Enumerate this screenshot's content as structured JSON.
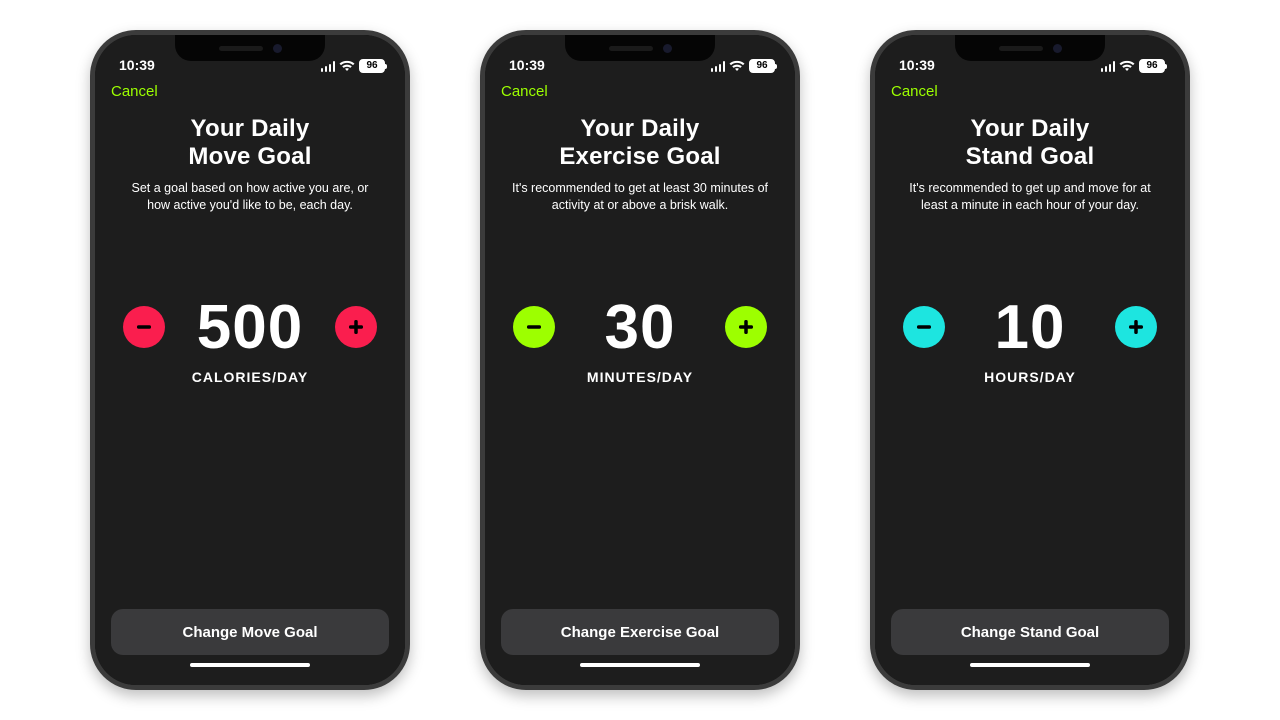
{
  "status": {
    "time": "10:39",
    "battery": "96"
  },
  "nav": {
    "cancel": "Cancel"
  },
  "screens": [
    {
      "title_line1": "Your Daily",
      "title_line2": "Move Goal",
      "subtitle": "Set a goal based on how active you are, or how active you'd like to be, each day.",
      "value": "500",
      "unit": "CALORIES/DAY",
      "cta": "Change Move Goal",
      "accent": "#fa1e4e",
      "accent_class": "accent-move"
    },
    {
      "title_line1": "Your Daily",
      "title_line2": "Exercise Goal",
      "subtitle": "It's recommended to get at least 30 minutes of activity at or above a brisk walk.",
      "value": "30",
      "unit": "MINUTES/DAY",
      "cta": "Change Exercise Goal",
      "accent": "#9dff00",
      "accent_class": "accent-ex"
    },
    {
      "title_line1": "Your Daily",
      "title_line2": "Stand Goal",
      "subtitle": "It's recommended to get up and move for at least a minute in each hour of your day.",
      "value": "10",
      "unit": "HOURS/DAY",
      "cta": "Change Stand Goal",
      "accent": "#1de5e0",
      "accent_class": "accent-stand"
    }
  ]
}
